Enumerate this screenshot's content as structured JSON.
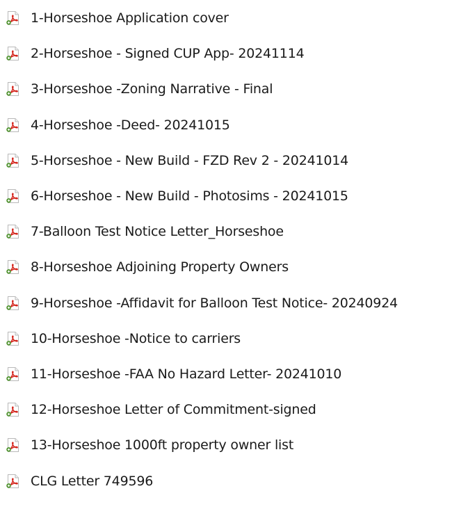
{
  "file_icon": "pdf-file-icon",
  "icon_colors": {
    "page_border": "#b9b9b9",
    "acrobat_red": "#d4251c",
    "badge_green": "#5b9a3c"
  },
  "files": [
    {
      "name": "1-Horseshoe Application cover"
    },
    {
      "name": "2-Horseshoe - Signed CUP App- 20241114"
    },
    {
      "name": "3-Horseshoe -Zoning Narrative - Final"
    },
    {
      "name": "4-Horseshoe -Deed- 20241015"
    },
    {
      "name": "5-Horseshoe - New Build - FZD Rev 2 - 20241014"
    },
    {
      "name": "6-Horseshoe - New Build - Photosims - 20241015"
    },
    {
      "name": "7-Balloon Test Notice Letter_Horseshoe"
    },
    {
      "name": "8-Horseshoe Adjoining Property Owners"
    },
    {
      "name": "9-Horseshoe -Affidavit for Balloon Test Notice- 20240924"
    },
    {
      "name": "10-Horseshoe -Notice to carriers"
    },
    {
      "name": "11-Horseshoe -FAA No Hazard Letter- 20241010"
    },
    {
      "name": "12-Horseshoe Letter of Commitment-signed"
    },
    {
      "name": "13-Horseshoe 1000ft property owner list"
    },
    {
      "name": "CLG Letter 749596"
    }
  ]
}
